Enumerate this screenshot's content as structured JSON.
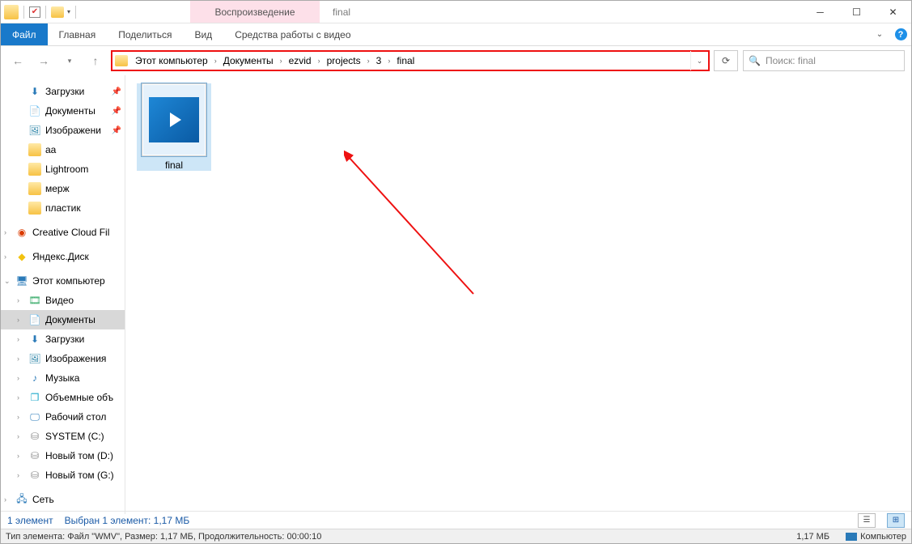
{
  "window": {
    "context_tab": "Воспроизведение",
    "title": "final"
  },
  "ribbon": {
    "file": "Файл",
    "home": "Главная",
    "share": "Поделиться",
    "view": "Вид",
    "video_tools": "Средства работы с видео"
  },
  "breadcrumbs": [
    "Этот компьютер",
    "Документы",
    "ezvid",
    "projects",
    "3",
    "final"
  ],
  "search": {
    "placeholder": "Поиск: final"
  },
  "tree": {
    "items": [
      {
        "label": "Загрузки",
        "icon": "dl",
        "pin": true,
        "level": 2
      },
      {
        "label": "Документы",
        "icon": "doc",
        "pin": true,
        "level": 2
      },
      {
        "label": "Изображени",
        "icon": "img",
        "pin": true,
        "level": 2
      },
      {
        "label": "aa",
        "icon": "folder",
        "level": 2
      },
      {
        "label": "Lightroom",
        "icon": "folder",
        "level": 2
      },
      {
        "label": "мерж",
        "icon": "folder",
        "level": 2
      },
      {
        "label": "пластик",
        "icon": "folder",
        "level": 2
      },
      {
        "label": "",
        "spacer": true
      },
      {
        "label": "Creative Cloud Fil",
        "icon": "cc",
        "level": 1,
        "exp": ">"
      },
      {
        "label": "",
        "spacer": true
      },
      {
        "label": "Яндекс.Диск",
        "icon": "yd",
        "level": 1,
        "exp": ">"
      },
      {
        "label": "",
        "spacer": true
      },
      {
        "label": "Этот компьютер",
        "icon": "pc",
        "level": 1,
        "exp": "v"
      },
      {
        "label": "Видео",
        "icon": "vid",
        "level": 2,
        "exp": ">"
      },
      {
        "label": "Документы",
        "icon": "doc",
        "level": 2,
        "sel": true,
        "exp": ">"
      },
      {
        "label": "Загрузки",
        "icon": "dl",
        "level": 2,
        "exp": ">"
      },
      {
        "label": "Изображения",
        "icon": "img",
        "level": 2,
        "exp": ">"
      },
      {
        "label": "Музыка",
        "icon": "mus",
        "level": 2,
        "exp": ">"
      },
      {
        "label": "Объемные объ",
        "icon": "obj",
        "level": 2,
        "exp": ">"
      },
      {
        "label": "Рабочий стол",
        "icon": "desk",
        "level": 2,
        "exp": ">"
      },
      {
        "label": "SYSTEM (C:)",
        "icon": "drv",
        "level": 2,
        "exp": ">"
      },
      {
        "label": "Новый том (D:)",
        "icon": "drv",
        "level": 2,
        "exp": ">"
      },
      {
        "label": "Новый том (G:)",
        "icon": "drv",
        "level": 2,
        "exp": ">"
      },
      {
        "label": "",
        "spacer": true
      },
      {
        "label": "Сеть",
        "icon": "net",
        "level": 1,
        "exp": ">"
      }
    ]
  },
  "files": [
    {
      "name": "final",
      "selected": true
    }
  ],
  "status": {
    "count": "1 элемент",
    "selection": "Выбран 1 элемент: 1,17 МБ"
  },
  "details": {
    "line": "Тип элемента: Файл \"WMV\", Размер: 1,17 МБ, Продолжительность: 00:00:10",
    "size": "1,17 МБ",
    "location": "Компьютер"
  }
}
